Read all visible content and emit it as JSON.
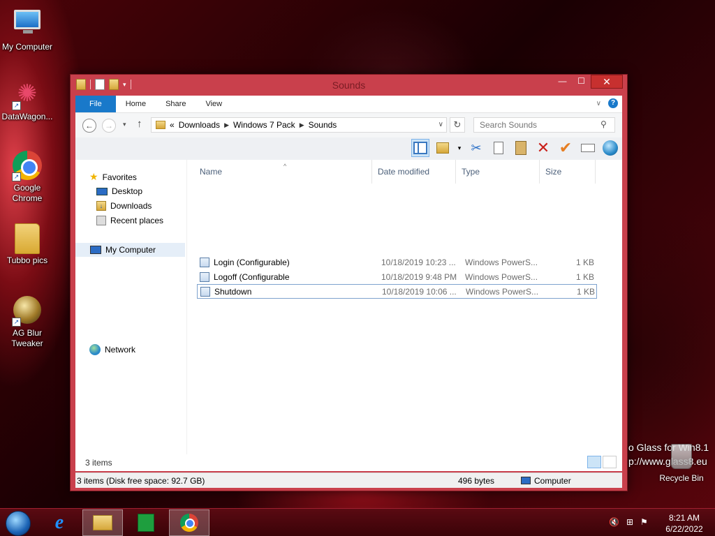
{
  "desktop": {
    "icons": [
      {
        "label": "My Computer"
      },
      {
        "label": "DataWagon..."
      },
      {
        "label": "Google Chrome"
      },
      {
        "label": "Tubbo pics"
      },
      {
        "label": "AG Blur Tweaker"
      }
    ],
    "glass_text_line1": "o Glass for Win8.1",
    "glass_text_line2": "p://www.glass8.eu",
    "recycle_bin_label": "Recycle Bin"
  },
  "window": {
    "title": "Sounds",
    "caption": {
      "minimize": "—",
      "maximize": "☐",
      "close": "✕"
    },
    "ribbon_tabs": [
      "File",
      "Home",
      "Share",
      "View"
    ],
    "address": {
      "overflow": "«",
      "crumbs": [
        "Downloads",
        "Windows 7 Pack",
        "Sounds"
      ]
    },
    "search_placeholder": "Search Sounds",
    "nav_pane": {
      "favorites": "Favorites",
      "favorites_items": [
        "Desktop",
        "Downloads",
        "Recent places"
      ],
      "computer": "My Computer",
      "network": "Network"
    },
    "columns": [
      "Name",
      "Date modified",
      "Type",
      "Size"
    ],
    "files": [
      {
        "name": "Login (Configurable)",
        "date": "10/18/2019 10:23 ...",
        "type": "Windows PowerS...",
        "size": "1 KB"
      },
      {
        "name": "Logoff (Configurable",
        "date": "10/18/2019 9:48 PM",
        "type": "Windows PowerS...",
        "size": "1 KB"
      },
      {
        "name": "Shutdown",
        "date": "10/18/2019 10:06 ...",
        "type": "Windows PowerS...",
        "size": "1 KB"
      }
    ],
    "status_count": "3 items",
    "details": {
      "summary": "3 items (Disk free space: 92.7 GB)",
      "bytes": "496 bytes",
      "location": "Computer"
    }
  },
  "taskbar": {
    "time": "8:21 AM",
    "date": "6/22/2022"
  }
}
